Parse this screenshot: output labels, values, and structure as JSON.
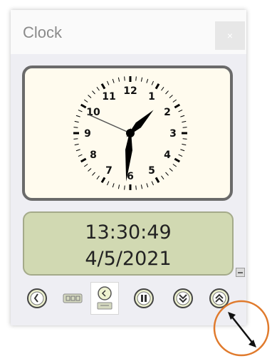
{
  "window": {
    "title": "Clock",
    "close_glyph": "×"
  },
  "analog": {
    "numerals": [
      "12",
      "1",
      "2",
      "3",
      "4",
      "5",
      "6",
      "7",
      "8",
      "9",
      "10",
      "11"
    ],
    "time": {
      "hours": 13,
      "minutes": 30,
      "seconds": 49
    },
    "face_color": "#fffbee",
    "hand_color": "#000000",
    "second_hand_color": "#555555"
  },
  "digital": {
    "time": "13:30:49",
    "date": "4/5/2021",
    "background": "#d1d9b2"
  },
  "toolbar": {
    "buttons": [
      {
        "name": "analog-mode-icon"
      },
      {
        "name": "digital-mode-icon"
      },
      {
        "name": "both-mode-icon"
      },
      {
        "name": "pause-icon"
      },
      {
        "name": "collapse-down-icon"
      },
      {
        "name": "expand-up-icon"
      }
    ]
  },
  "annotation": {
    "circle_color": "#e07a2c"
  }
}
